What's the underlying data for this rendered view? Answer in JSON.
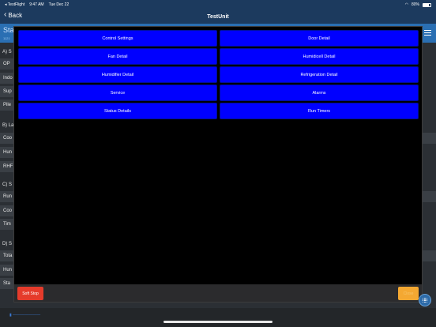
{
  "status_bar": {
    "app": "◂ TestFlight",
    "time": "9:47 AM",
    "date": "Tue Dec 22",
    "battery": "80%"
  },
  "nav": {
    "back_label": "Back",
    "title": "TestUnit"
  },
  "background": {
    "header_title": "Sta",
    "header_sub": "1121",
    "sections": [
      {
        "label": "A) S",
        "rows": [
          "OP",
          "Indo",
          "Sup",
          "Pile"
        ]
      },
      {
        "label": "B) La",
        "rows": [
          "Coo",
          "Hun",
          "RHF"
        ]
      },
      {
        "label": "C) S",
        "rows": [
          "Run",
          "Coo",
          "Tim"
        ]
      },
      {
        "label": "D) S",
        "rows": [
          "Tota",
          "Hun",
          "Sta"
        ]
      }
    ]
  },
  "menu": {
    "left": [
      "Control Settings",
      "Fan Detail",
      "Humidifier Detail",
      "Service",
      "Status Details"
    ],
    "right": [
      "Door Detail",
      "Humidicell Detail",
      "Refrigeration Detail",
      "Alarms",
      "Run Timers"
    ]
  },
  "footer": {
    "soft_stop": "Soft Stop",
    "close": "Close"
  },
  "colors": {
    "menu_button": "#0000ff",
    "soft_stop": "#e53b2b",
    "close": "#f4a832",
    "nav": "#1c3a5e"
  }
}
